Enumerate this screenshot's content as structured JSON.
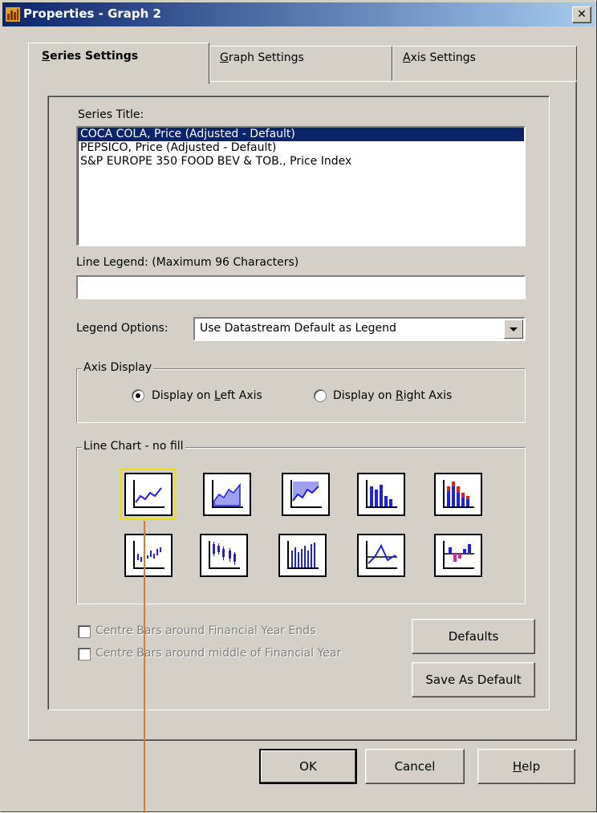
{
  "window": {
    "title": "Properties - Graph 2",
    "close_glyph": "✕"
  },
  "tabs": [
    {
      "label": "Series Settings",
      "underline": "S",
      "rest": "eries Settings",
      "active": true
    },
    {
      "label": "Graph Settings",
      "underline": "G",
      "rest": "raph Settings",
      "active": false
    },
    {
      "label": "Axis Settings",
      "underline": "A",
      "rest": "xis Settings",
      "active": false
    }
  ],
  "series": {
    "title_label": "Series Title:",
    "items": [
      "COCA COLA, Price (Adjusted - Default)",
      "PEPSICO, Price (Adjusted - Default)",
      "S&P EUROPE 350 FOOD BEV & TOB., Price Index"
    ],
    "selected_index": 0
  },
  "line_legend": {
    "label": "Line Legend: (Maximum 96 Characters)",
    "value": ""
  },
  "legend_options": {
    "label": "Legend Options:",
    "selected": "Use Datastream Default as Legend"
  },
  "axis_display": {
    "group_label": "Axis Display",
    "left_pre": "Display on ",
    "left_u": "L",
    "left_post": "eft Axis",
    "right_pre": "Display on ",
    "right_u": "R",
    "right_post": "ight Axis",
    "selected": "left"
  },
  "chart_type": {
    "group_label": "Line Chart - no fill",
    "icons": [
      "line-chart-icon",
      "area-chart-icon",
      "area-fill-above-icon",
      "bar-chart-icon",
      "stacked-bar-chart-icon",
      "floating-bar-icon",
      "candlestick-icon",
      "high-low-bar-icon",
      "line-with-axis-icon",
      "step-bar-icon"
    ],
    "selected_index": 0
  },
  "options": {
    "centre_year_ends": "Centre Bars around Financial Year Ends",
    "centre_middle": "Centre Bars around middle of Financial Year"
  },
  "buttons": {
    "defaults": "Defaults",
    "save_default": "Save As Default",
    "ok": "OK",
    "cancel": "Cancel",
    "help_u": "H",
    "help_rest": "elp"
  },
  "colors": {
    "title_gradient_start": "#0a246a",
    "selection": "#0a246a",
    "chart_line": "#2020e0",
    "chart_fill": "#a0a0f0",
    "chart_red": "#e02020",
    "pointer": "#e07830"
  }
}
